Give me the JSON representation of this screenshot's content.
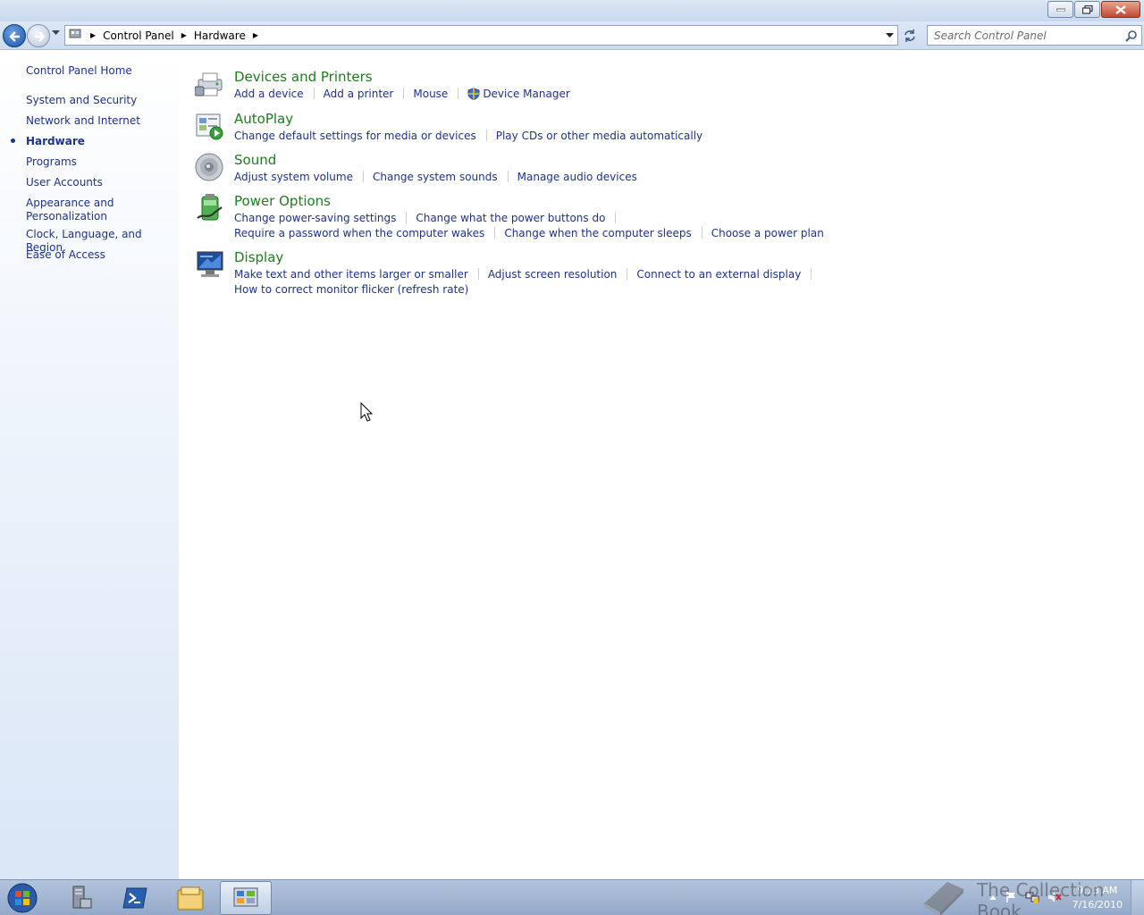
{
  "window": {
    "buttons": [
      "minimize",
      "restore",
      "close"
    ]
  },
  "nav": {
    "breadcrumb": [
      "Control Panel",
      "Hardware"
    ],
    "search_placeholder": "Search Control Panel"
  },
  "sidebar": {
    "items": [
      {
        "label": "Control Panel Home",
        "active": false
      },
      {
        "label": "System and Security",
        "active": false
      },
      {
        "label": "Network and Internet",
        "active": false
      },
      {
        "label": "Hardware",
        "active": true
      },
      {
        "label": "Programs",
        "active": false
      },
      {
        "label": "User Accounts",
        "active": false
      },
      {
        "label": "Appearance and Personalization",
        "active": false
      },
      {
        "label": "Clock, Language, and Region",
        "active": false
      },
      {
        "label": "Ease of Access",
        "active": false
      }
    ]
  },
  "categories": [
    {
      "title": "Devices and Printers",
      "icon": "printer-icon",
      "link_rows": [
        [
          "Add a device",
          "Add a printer",
          "Mouse",
          "Device Manager"
        ]
      ]
    },
    {
      "title": "AutoPlay",
      "icon": "autoplay-icon",
      "link_rows": [
        [
          "Change default settings for media or devices",
          "Play CDs or other media automatically"
        ]
      ]
    },
    {
      "title": "Sound",
      "icon": "speaker-icon",
      "link_rows": [
        [
          "Adjust system volume",
          "Change system sounds",
          "Manage audio devices"
        ]
      ]
    },
    {
      "title": "Power Options",
      "icon": "battery-icon",
      "link_rows": [
        [
          "Change power-saving settings",
          "Change what the power buttons do"
        ],
        [
          "Require a password when the computer wakes",
          "Change when the computer sleeps",
          "Choose a power plan"
        ]
      ]
    },
    {
      "title": "Display",
      "icon": "monitor-icon",
      "link_rows": [
        [
          "Make text and other items larger or smaller",
          "Adjust screen resolution",
          "Connect to an external display"
        ],
        [
          "How to correct monitor flicker (refresh rate)"
        ]
      ]
    }
  ],
  "taskbar": {
    "apps": [
      "server-manager-icon",
      "powershell-icon",
      "explorer-icon",
      "control-panel-icon"
    ],
    "time": "9:13 AM",
    "date": "7/16/2010"
  },
  "watermark": "The Collection Book",
  "colors": {
    "link": "#1e3287",
    "category_title": "#1e7b1e",
    "sidebar_bg_bottom": "#dbe7f7"
  }
}
